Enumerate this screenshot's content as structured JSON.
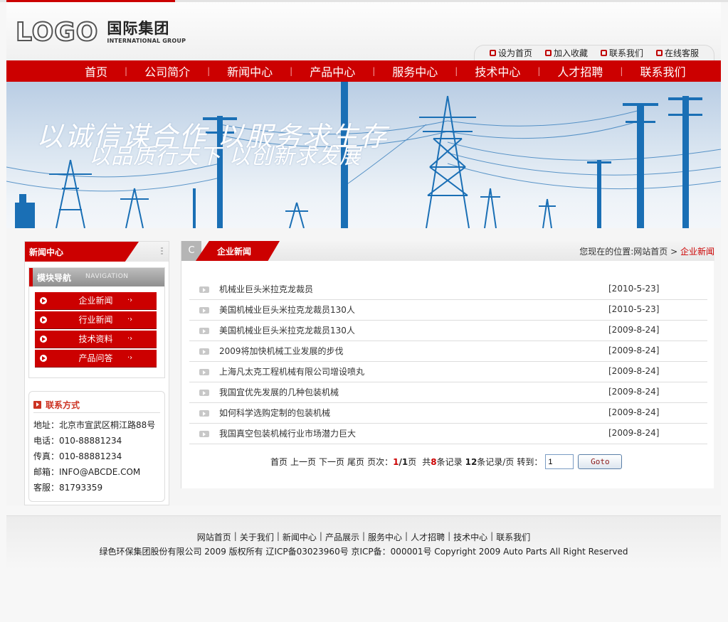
{
  "header": {
    "logo_mark": "LOGO",
    "logo_cn": "国际集团",
    "logo_en": "INTERNATIONAL GROUP",
    "quick_links": [
      {
        "label": "设为首页",
        "icon": "home-icon"
      },
      {
        "label": "加入收藏",
        "icon": "bookmark-icon"
      },
      {
        "label": "联系我们",
        "icon": "mail-icon"
      },
      {
        "label": "在线客服",
        "icon": "service-icon"
      }
    ]
  },
  "nav": [
    "首页",
    "公司简介",
    "新闻中心",
    "产品中心",
    "服务中心",
    "技术中心",
    "人才招聘",
    "联系我们"
  ],
  "banner": {
    "slogan1": "以诚信谋合作 以服务求生存",
    "slogan2": "以品质行天下 以创新求发展"
  },
  "sidebar": {
    "title": "新闻中心",
    "module_nav_title": "模块导航",
    "module_nav_en": "NAVIGATION",
    "menu": [
      "企业新闻",
      "行业新闻",
      "技术资料",
      "产品问答"
    ],
    "contact_title": "联系方式",
    "contact": [
      "地址：北京市宣武区桐江路88号",
      "电话：010-88881234",
      "传真：010-88881234",
      "邮箱：INFO@ABCDE.COM",
      "客服：81793359"
    ]
  },
  "main": {
    "c_icon": "C",
    "title": "企业新闻",
    "breadcrumb_prefix": "您现在的位置:网站首页 > ",
    "breadcrumb_current": "企业新闻",
    "news": [
      {
        "title": "机械业巨头米拉克龙裁员",
        "date": "[2010-5-23]"
      },
      {
        "title": "美国机械业巨头米拉克龙裁员130人",
        "date": "[2010-5-23]"
      },
      {
        "title": "美国机械业巨头米拉克龙裁员130人",
        "date": "[2009-8-24]"
      },
      {
        "title": "2009将加快机械工业发展的步伐",
        "date": "[2009-8-24]"
      },
      {
        "title": "上海凡太克工程机械有限公司增设喷丸",
        "date": "[2009-8-24]"
      },
      {
        "title": "我国宜优先发展的几种包装机械",
        "date": "[2009-8-24]"
      },
      {
        "title": "如何科学选购定制的包装机械",
        "date": "[2009-8-24]"
      },
      {
        "title": "我国真空包装机械行业市场潜力巨大",
        "date": "[2009-8-24]"
      }
    ],
    "pager": {
      "first": "首页",
      "prev": "上一页",
      "next": "下一页",
      "last": "尾页",
      "page_label": "页次：",
      "current_page": "1",
      "slash": "/",
      "total_pages": "1",
      "page_unit": "页",
      "total_prefix": "共",
      "total_records": "8",
      "records_unit": "条记录",
      "per_page": "12",
      "per_page_unit": "条记录/页",
      "goto_label": "转到：",
      "goto_value": "1",
      "goto_button": "Goto"
    }
  },
  "footer": {
    "links": [
      "网站首页",
      "关于我们",
      "新闻中心",
      "产品展示",
      "服务中心",
      "人才招聘",
      "技术中心",
      "联系我们"
    ],
    "copyright": "绿色环保集团股份有限公司 2009 版权所有 辽ICP备03023960号 京ICP备：000001号 Copyright 2009 Auto Parts All Right Reserved"
  },
  "colors": {
    "accent": "#cc0000",
    "banner_sky": "#c9d8ea",
    "tower": "#1a6fb5"
  }
}
